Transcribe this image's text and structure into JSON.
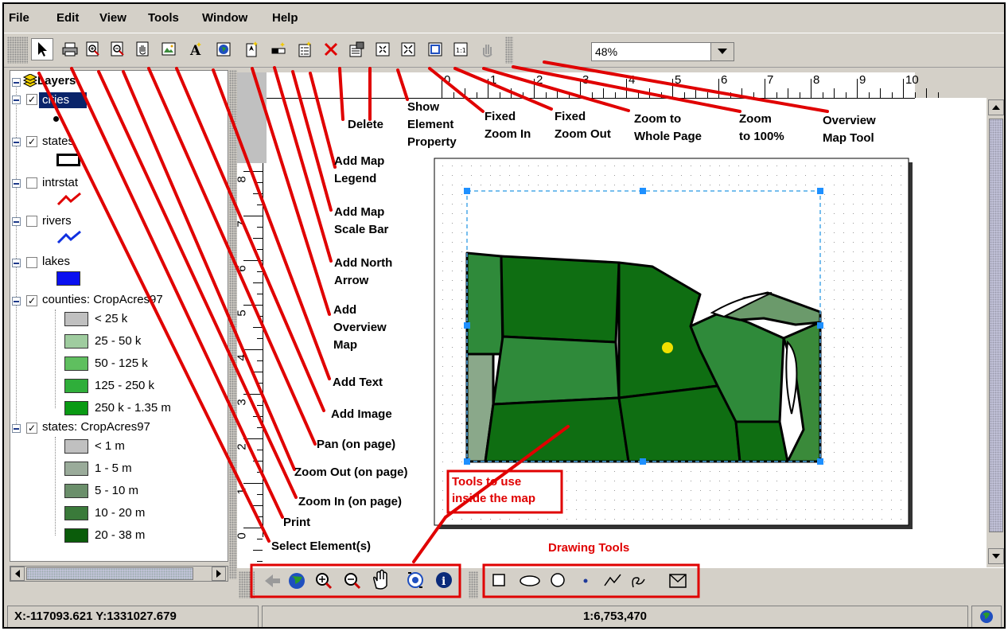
{
  "menu": {
    "items": [
      "File",
      "Edit",
      "View",
      "Tools",
      "Window",
      "Help"
    ]
  },
  "toolbar": {
    "zoom_value": "48%"
  },
  "layers": {
    "root_label": "Layers",
    "items": [
      {
        "label": "cities",
        "checked": true,
        "selected": true
      },
      {
        "label": "states",
        "checked": true
      },
      {
        "label": "intrstat",
        "checked": false
      },
      {
        "label": "rivers",
        "checked": false
      },
      {
        "label": "lakes",
        "checked": false
      },
      {
        "label": "counties: CropAcres97",
        "checked": true
      },
      {
        "label": "states: CropAcres97",
        "checked": true
      }
    ],
    "counties_legend": [
      {
        "label": "< 25 k",
        "color": "#c0c0c0"
      },
      {
        "label": "25 - 50 k",
        "color": "#9fcc9f"
      },
      {
        "label": "50 - 125 k",
        "color": "#5fbf5f"
      },
      {
        "label": "125 - 250 k",
        "color": "#2fae3a"
      },
      {
        "label": "250 k - 1.35 m",
        "color": "#0a9a14"
      }
    ],
    "states_legend": [
      {
        "label": "< 1 m",
        "color": "#c0c0c0"
      },
      {
        "label": "1 - 5 m",
        "color": "#9aab9a"
      },
      {
        "label": "5 - 10 m",
        "color": "#6b8f6b"
      },
      {
        "label": "10 - 20 m",
        "color": "#3a7a3a"
      },
      {
        "label": "20 - 38 m",
        "color": "#0a5c0a"
      }
    ]
  },
  "ruler": {
    "h_marks": [
      "0",
      "1",
      "2",
      "3",
      "4",
      "5",
      "6",
      "7",
      "8",
      "9",
      "10"
    ],
    "v_marks": [
      "8",
      "7",
      "6",
      "5",
      "4",
      "3",
      "2",
      "1",
      "0"
    ]
  },
  "annotations": {
    "delete": "Delete",
    "show_element_property": [
      "Show",
      "Element",
      "Property"
    ],
    "fixed_zoom_in": [
      "Fixed",
      "Zoom In"
    ],
    "fixed_zoom_out": [
      "Fixed",
      "Zoom Out"
    ],
    "zoom_whole_page": [
      "Zoom to",
      "Whole Page"
    ],
    "zoom_100": [
      "Zoom",
      "to 100%"
    ],
    "overview_map_tool": [
      "Overview",
      "Map Tool"
    ],
    "add_map_legend": [
      "Add Map",
      "Legend"
    ],
    "add_map_scale_bar": [
      "Add Map",
      "Scale Bar"
    ],
    "add_north_arrow": [
      "Add North",
      "Arrow"
    ],
    "add_overview_map": [
      "Add",
      "Overview",
      "Map"
    ],
    "add_text": "Add Text",
    "add_image": "Add Image",
    "pan_on_page": "Pan (on page)",
    "zoom_out_on_page": "Zoom Out (on page)",
    "zoom_in_on_page": "Zoom In (on page)",
    "print": "Print",
    "select_elements": "Select Element(s)",
    "tools_inside_map": [
      "Tools to use",
      "inside the map"
    ],
    "drawing_tools": "Drawing Tools"
  },
  "status": {
    "coords": "X:-117093.621 Y:1331027.679",
    "scale": "1:6,753,470"
  },
  "colors": {
    "annotation_red": "#e00000",
    "map_green": "#0f6e12",
    "selection_blue": "#0a246a"
  },
  "icons": {
    "toolbar": [
      "select-arrow-icon",
      "print-icon",
      "zoom-in-page-icon",
      "zoom-out-page-icon",
      "pan-page-icon",
      "add-image-icon",
      "add-text-icon",
      "add-overview-map-icon",
      "add-north-arrow-icon",
      "add-scale-bar-icon",
      "add-legend-icon",
      "delete-icon",
      "properties-icon",
      "fixed-zoom-in-icon",
      "fixed-zoom-out-icon",
      "zoom-whole-page-icon",
      "zoom-100-icon",
      "overview-hand-icon"
    ],
    "map_tools": [
      "back-extent-icon",
      "full-extent-icon",
      "zoom-in-icon",
      "zoom-out-icon",
      "pan-icon",
      "identify-icon",
      "info-icon"
    ],
    "drawing_tools": [
      "rectangle-icon",
      "ellipse-icon",
      "circle-icon",
      "point-icon",
      "polyline-icon",
      "freehand-icon",
      "polygon-icon"
    ]
  }
}
